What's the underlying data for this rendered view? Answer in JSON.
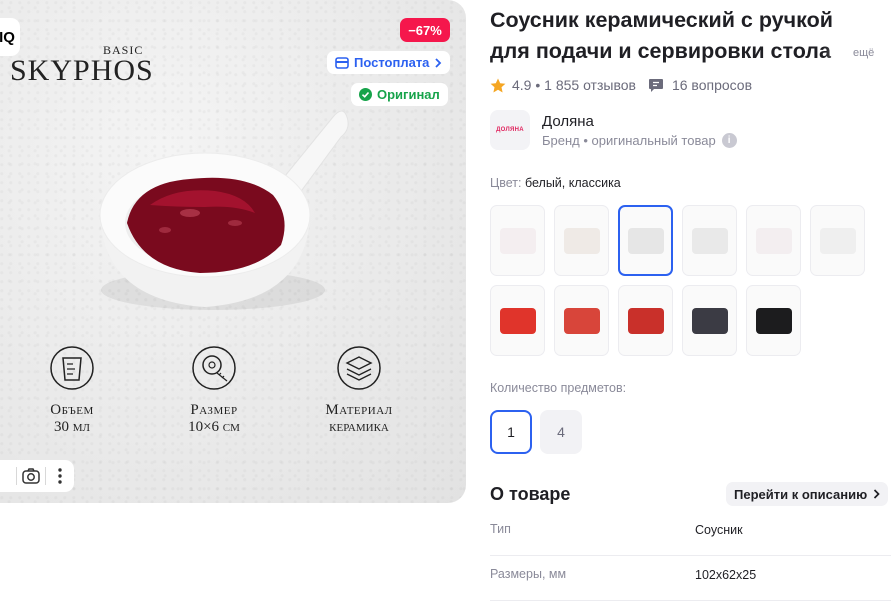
{
  "gallery": {
    "logo_text": "IQ",
    "brand_small": "BASIC",
    "brand_main": "SKYPHOS",
    "discount": "−67%",
    "badges": {
      "postpay": "Постоплата",
      "original": "Оригинал"
    },
    "features": [
      {
        "line1": "Объем",
        "line2": "30 мл",
        "icon": "measuring-cup-icon"
      },
      {
        "line1": "Размер",
        "line2": "10×6 см",
        "icon": "tape-measure-icon"
      },
      {
        "line1": "Материал",
        "line2": "керамика",
        "icon": "layers-icon"
      }
    ],
    "toolbar_icons": [
      "camera-icon",
      "more-vertical-icon"
    ]
  },
  "product": {
    "title_line1": "Соусник керамический с ручкой",
    "title_line2": "для подачи и сервировки стола",
    "more_label": "ещё",
    "rating": "4.9",
    "reviews": "1 855 отзывов",
    "questions": "16 вопросов",
    "brand_name": "Доляна",
    "brand_logo_text": "ДОЛЯНА",
    "brand_sub": "Бренд • оригинальный товар",
    "color_label": "Цвет:",
    "color_value": "белый, классика",
    "qty_label": "Количество предметов:",
    "qty_options": [
      "1",
      "4"
    ],
    "about_title": "О товаре",
    "about_link": "Перейти к описанию",
    "props": [
      {
        "key": "Тип",
        "value": "Соусник"
      },
      {
        "key": "Размеры, мм",
        "value": "102x62x25"
      }
    ]
  },
  "colors": {
    "accent": "#2c61f0",
    "discount": "#f5174c",
    "original": "#16a34a",
    "star": "#f5a623"
  }
}
